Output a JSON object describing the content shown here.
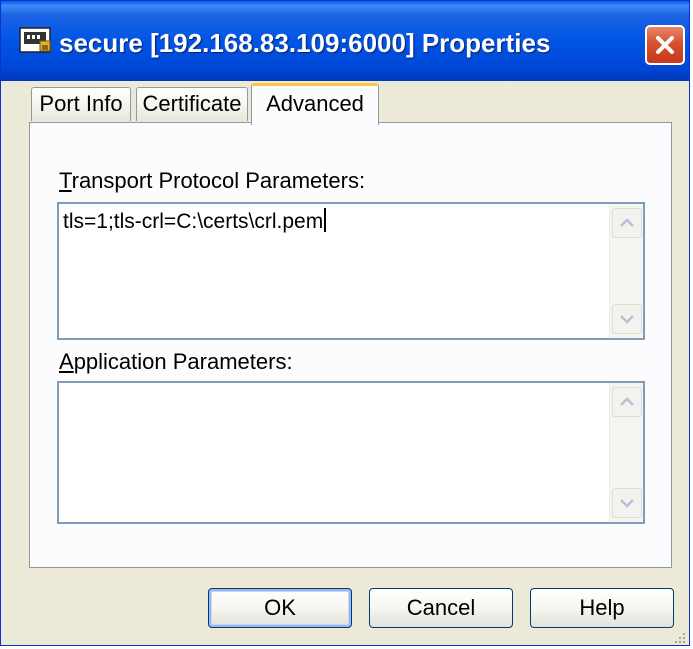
{
  "window": {
    "title": "secure [192.168.83.109:6000] Properties",
    "title_icon": "network-port-icon",
    "close_icon": "close-icon"
  },
  "tabs": [
    {
      "label": "Port Info",
      "active": false
    },
    {
      "label": "Certificate",
      "active": false
    },
    {
      "label": "Advanced",
      "active": true
    }
  ],
  "advanced": {
    "transport_label_hotkey": "T",
    "transport_label_rest": "ransport Protocol Parameters:",
    "transport_value": "tls=1;tls-crl=C:\\certs\\crl.pem",
    "application_label_hotkey": "A",
    "application_label_rest": "pplication Parameters:",
    "application_value": ""
  },
  "buttons": {
    "ok": "OK",
    "cancel": "Cancel",
    "help": "Help"
  },
  "colors": {
    "titlebar_blue": "#0055E5",
    "close_red": "#D8512E",
    "dialog_bg": "#ECE9D8",
    "active_tab_accent": "#FFC83C"
  }
}
